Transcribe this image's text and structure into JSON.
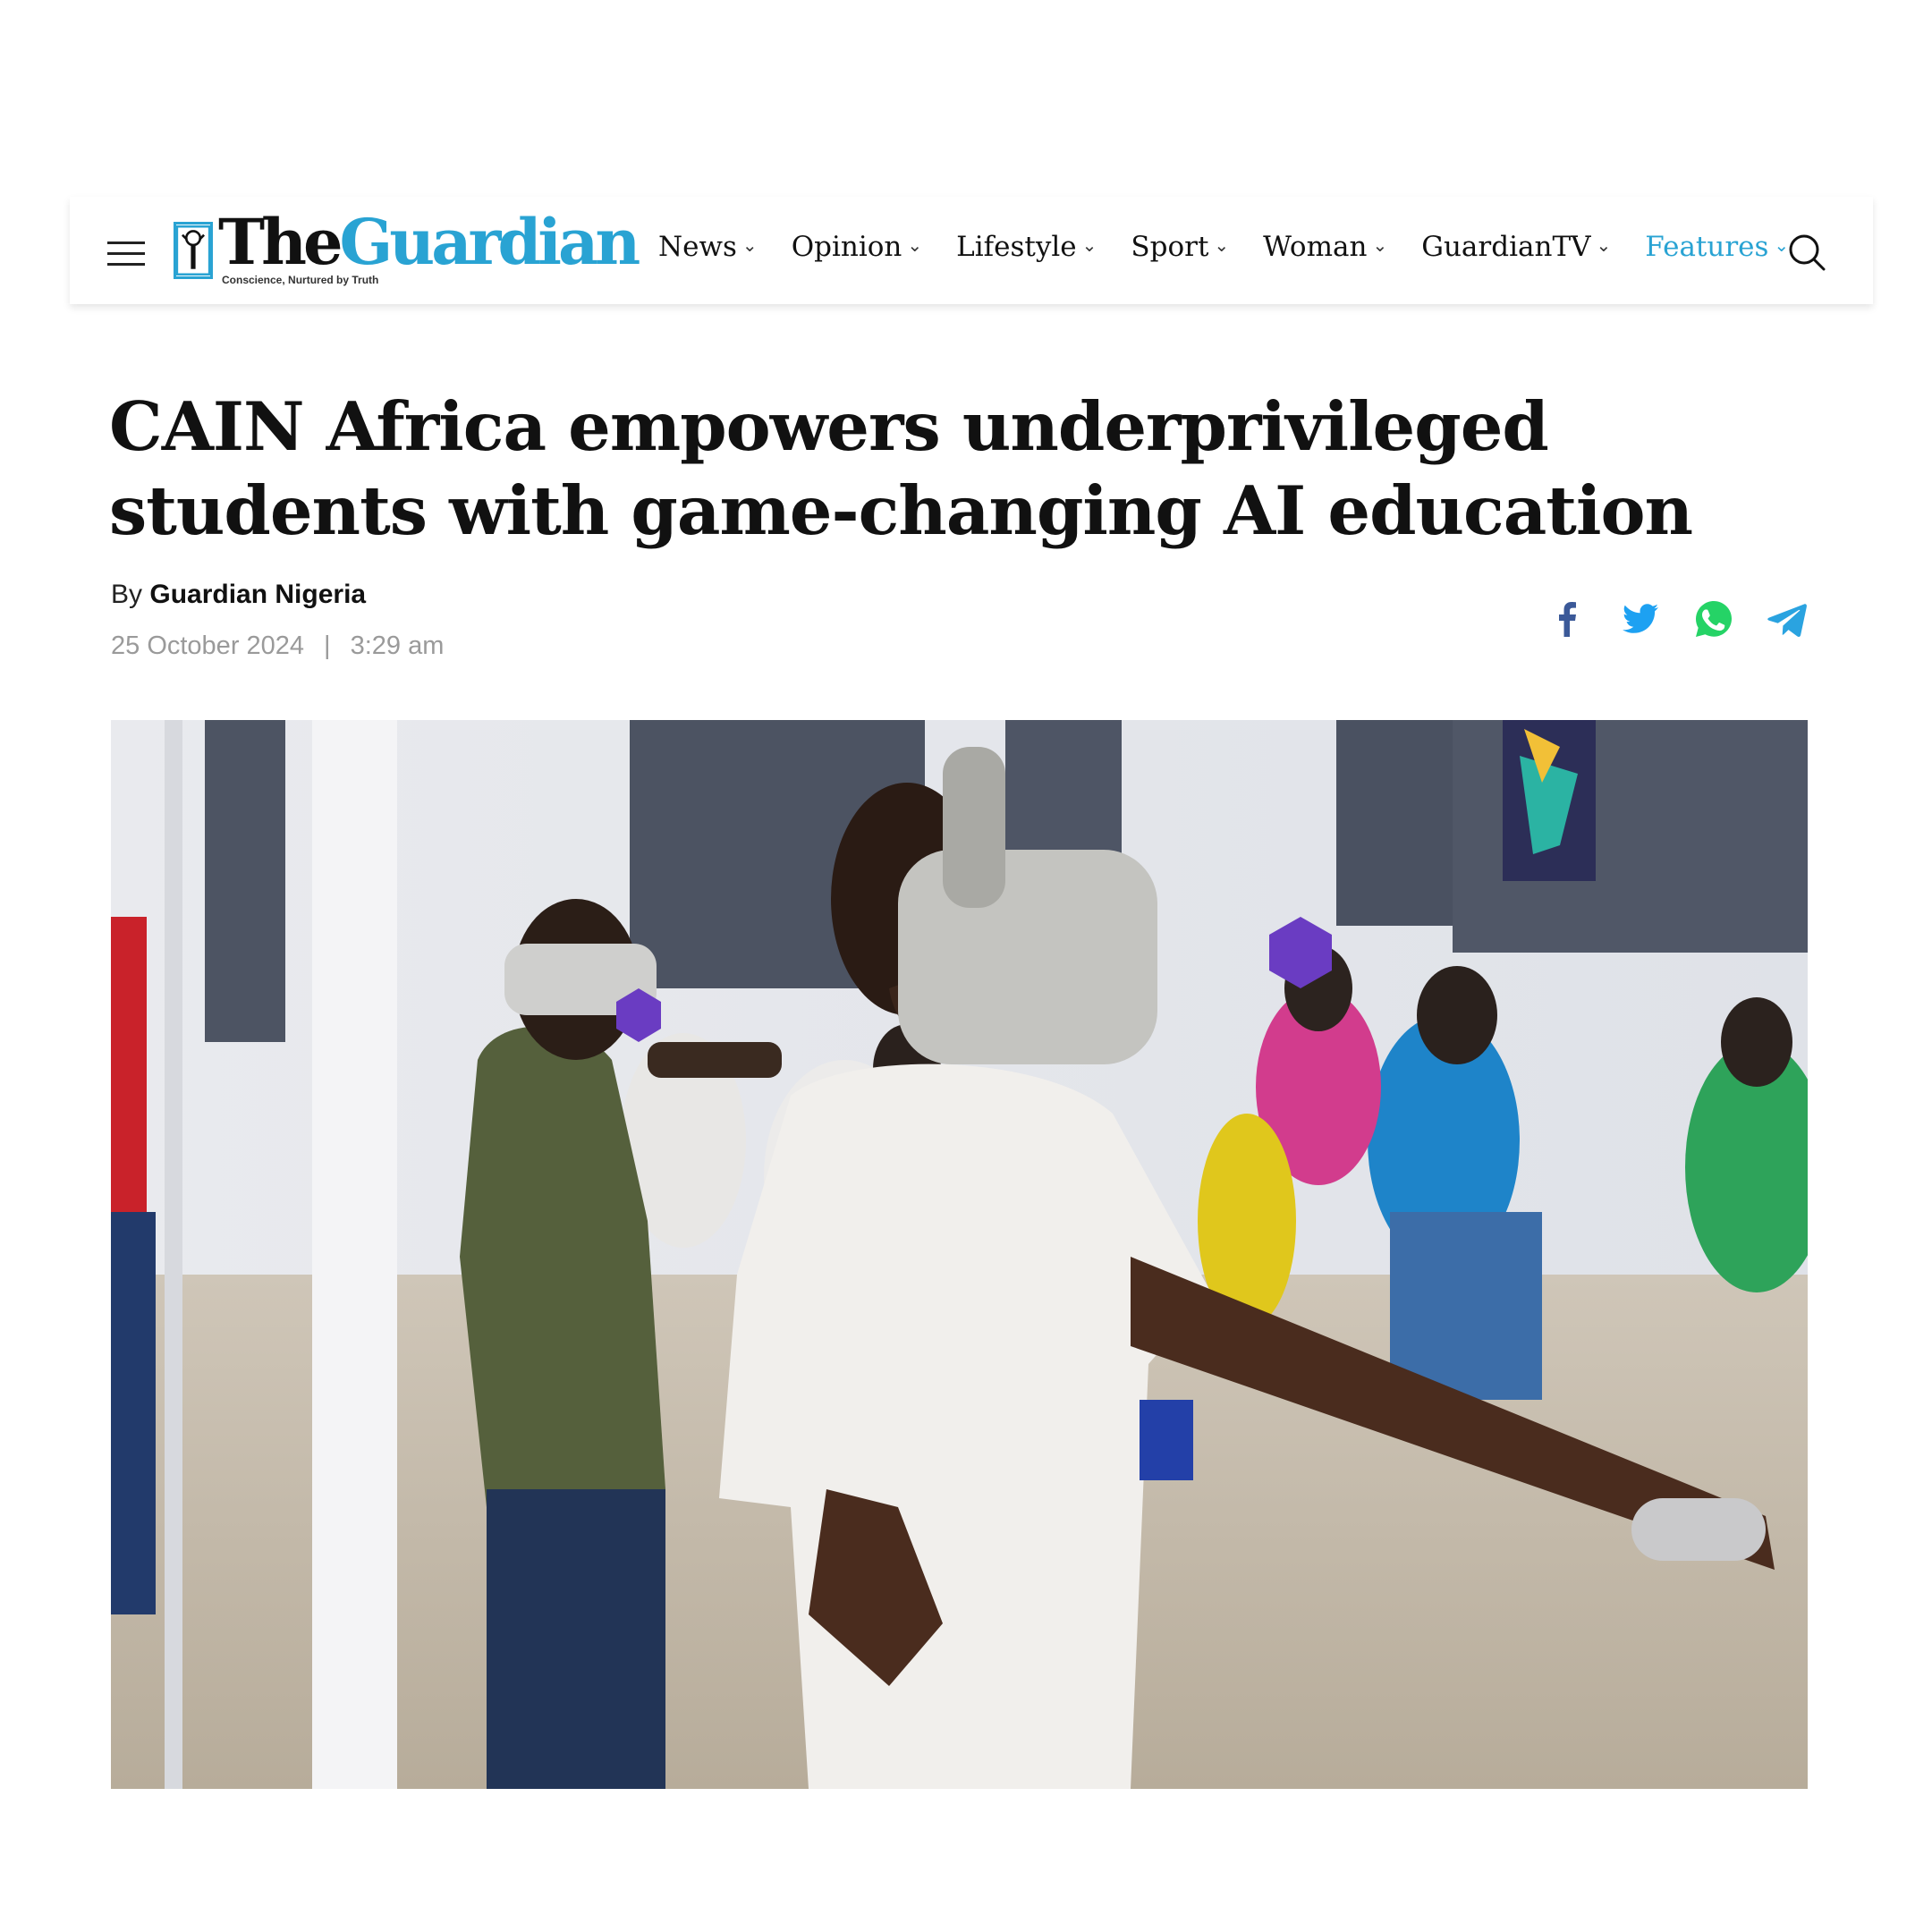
{
  "header": {
    "logo_the": "The",
    "logo_guardian": "Guardian",
    "logo_tagline": "Conscience, Nurtured by Truth",
    "nav": [
      {
        "label": "News"
      },
      {
        "label": "Opinion"
      },
      {
        "label": "Lifestyle"
      },
      {
        "label": "Sport"
      },
      {
        "label": "Woman"
      },
      {
        "label": "GuardianTV"
      },
      {
        "label": "Features",
        "active": true
      }
    ],
    "accent_color": "#29a3d3"
  },
  "article": {
    "headline": "CAIN Africa empowers underprivileged students with game-changing AI education",
    "by_prefix": "By",
    "author": "Guardian Nigeria",
    "date": "25 October 2024",
    "separator": "|",
    "time": "3:29 am"
  },
  "share": {
    "icons": [
      "facebook-icon",
      "twitter-icon",
      "whatsapp-icon",
      "telegram-icon"
    ],
    "colors": {
      "facebook": "#3b5998",
      "twitter": "#1da1f2",
      "whatsapp": "#25d366",
      "telegram": "#2aa3e0"
    }
  }
}
